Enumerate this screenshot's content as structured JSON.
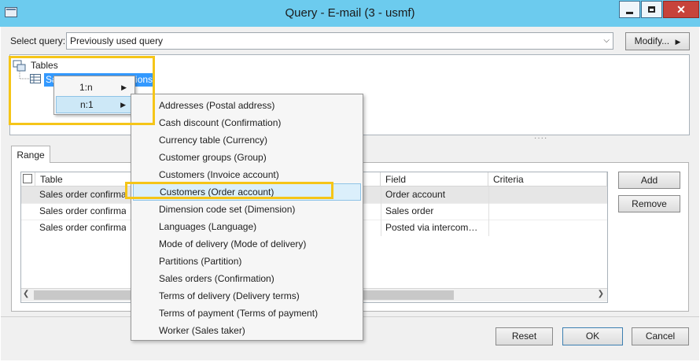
{
  "window": {
    "title": "Query - E-mail (3 - usmf)",
    "controls": {
      "minimize": "–",
      "maximize": "□",
      "close": "✕"
    }
  },
  "query": {
    "label": "Select query:",
    "value": "Previously used query",
    "modify_label": "Modify..."
  },
  "tree": {
    "root": "Tables",
    "child": "Sales order confirmations"
  },
  "relation_menu": {
    "items": [
      {
        "label": "1:n",
        "arrow": "▶"
      },
      {
        "label": "n:1",
        "arrow": "▶"
      }
    ]
  },
  "table_menu": {
    "items": [
      "Addresses (Postal address)",
      "Cash discount (Confirmation)",
      "Currency table (Currency)",
      "Customer groups (Group)",
      "Customers (Invoice account)",
      "Customers (Order account)",
      "Dimension code set (Dimension)",
      "Languages (Language)",
      "Mode of delivery (Mode of delivery)",
      "Partitions (Partition)",
      "Sales orders (Confirmation)",
      "Terms of delivery (Delivery terms)",
      "Terms of payment (Terms of payment)",
      "Worker (Sales taker)"
    ],
    "highlighted_index": 5
  },
  "range": {
    "tab_label": "Range",
    "columns": {
      "table": "Table",
      "field": "Field",
      "criteria": "Criteria"
    },
    "rows": [
      {
        "table": "Sales order confirmations",
        "field": "Order account",
        "criteria": ""
      },
      {
        "table": "Sales order confirmations",
        "field": "Sales order",
        "criteria": ""
      },
      {
        "table": "Sales order confirmations",
        "field": "Posted via intercompany",
        "criteria": ""
      }
    ],
    "add_label": "Add",
    "remove_label": "Remove"
  },
  "footer": {
    "reset_label": "Reset",
    "ok_label": "OK",
    "cancel_label": "Cancel"
  },
  "colors": {
    "titlebar": "#6ccbee",
    "highlight": "#f5c518",
    "selection": "#3399ff"
  }
}
